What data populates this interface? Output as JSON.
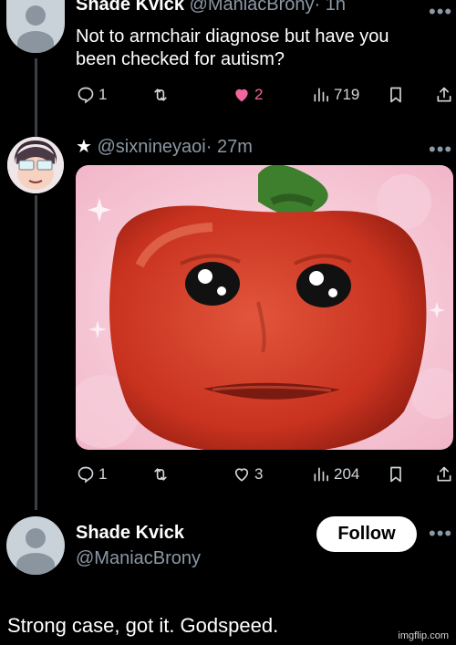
{
  "post1": {
    "name": "Shade Kvick",
    "handle": "@ManiacBrony",
    "time": "· 1h",
    "text_line1": "Not to armchair diagnose but have you",
    "text_line2": "been checked for autism?",
    "stats": {
      "replies": "1",
      "likes": "2",
      "views": "719"
    }
  },
  "post2": {
    "star": "★",
    "handle": "@sixnineyaoi",
    "time": "· 27m",
    "stats": {
      "replies": "1",
      "likes": "3",
      "views": "204"
    }
  },
  "reply": {
    "name": "Shade Kvick",
    "handle": "@ManiacBrony",
    "follow_label": "Follow",
    "text": "Strong case, got it. Godspeed."
  },
  "more_label": "•••",
  "watermark": "imgflip.com",
  "icons": {
    "reply": "reply-icon",
    "retweet": "retweet-icon",
    "like": "heart-icon",
    "views": "views-icon",
    "bookmark": "bookmark-icon",
    "share": "share-icon"
  },
  "colors": {
    "background": "#000000",
    "liked": "#f1669c",
    "muted": "#8b98a5"
  }
}
